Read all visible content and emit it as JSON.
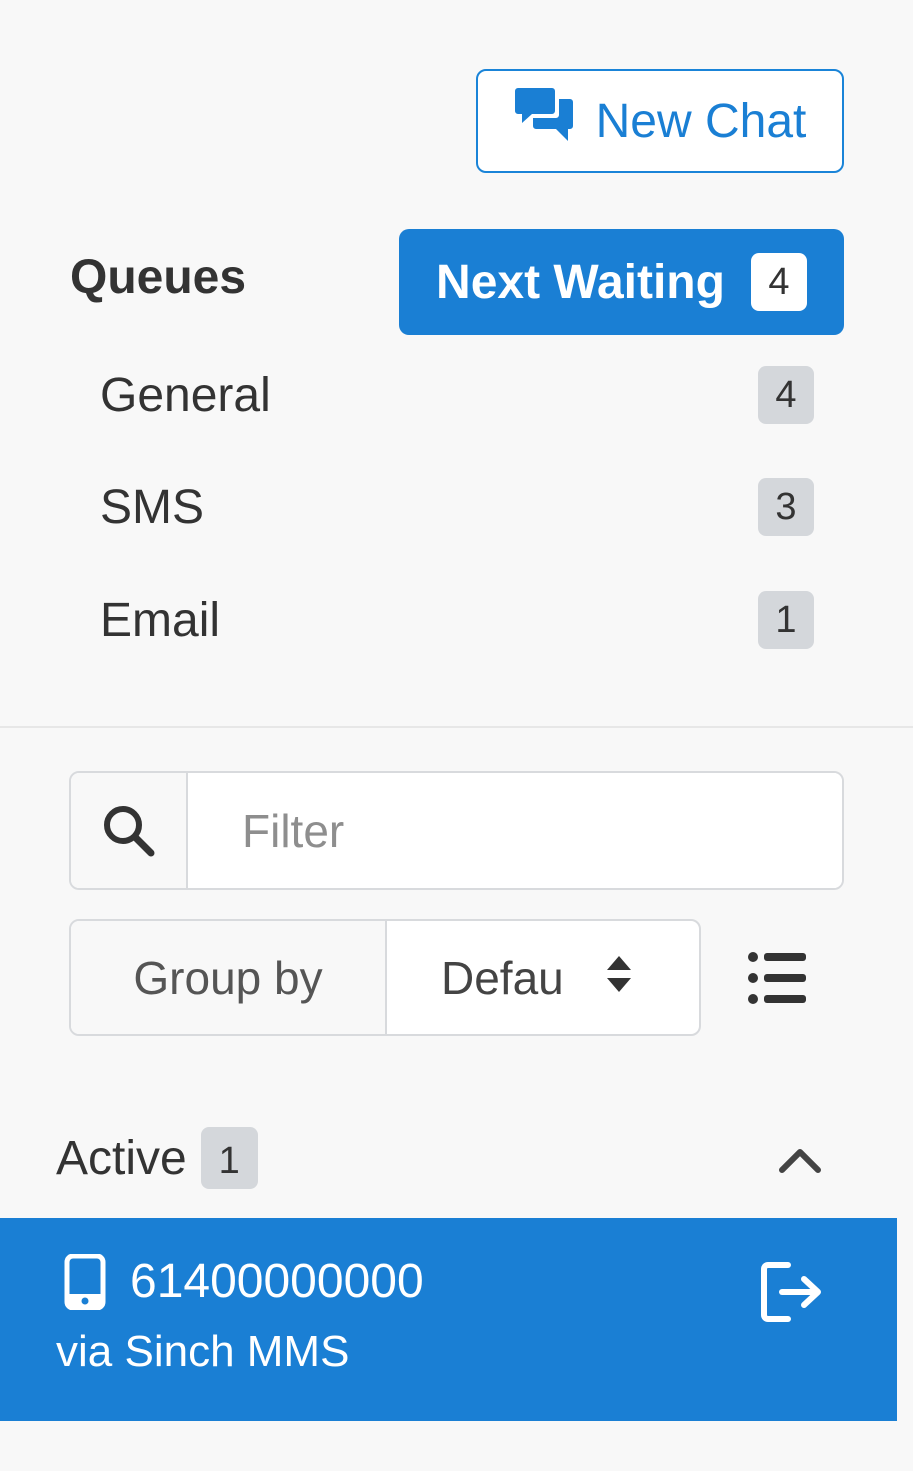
{
  "header": {
    "new_chat_label": "New Chat",
    "new_chat_icon": "comments-icon"
  },
  "queues": {
    "title": "Queues",
    "next_waiting_label": "Next Waiting",
    "next_waiting_count": "4",
    "items": [
      {
        "label": "General",
        "count": "4"
      },
      {
        "label": "SMS",
        "count": "3"
      },
      {
        "label": "Email",
        "count": "1"
      }
    ]
  },
  "filter": {
    "icon": "search-icon",
    "placeholder": "Filter",
    "value": ""
  },
  "group_by": {
    "label": "Group by",
    "selected": "Defau",
    "list_toggle_icon": "list-icon"
  },
  "active": {
    "title": "Active",
    "count": "1",
    "collapse_icon": "chevron-up-icon",
    "chats": [
      {
        "icon": "mobile-phone-icon",
        "number": "61400000000",
        "channel": "via Sinch MMS",
        "action_icon": "sign-out-icon"
      }
    ]
  },
  "colors": {
    "accent": "#1a7fd4",
    "background": "#f8f8f8",
    "badge_gray": "#d4d7db",
    "text": "#333333"
  }
}
